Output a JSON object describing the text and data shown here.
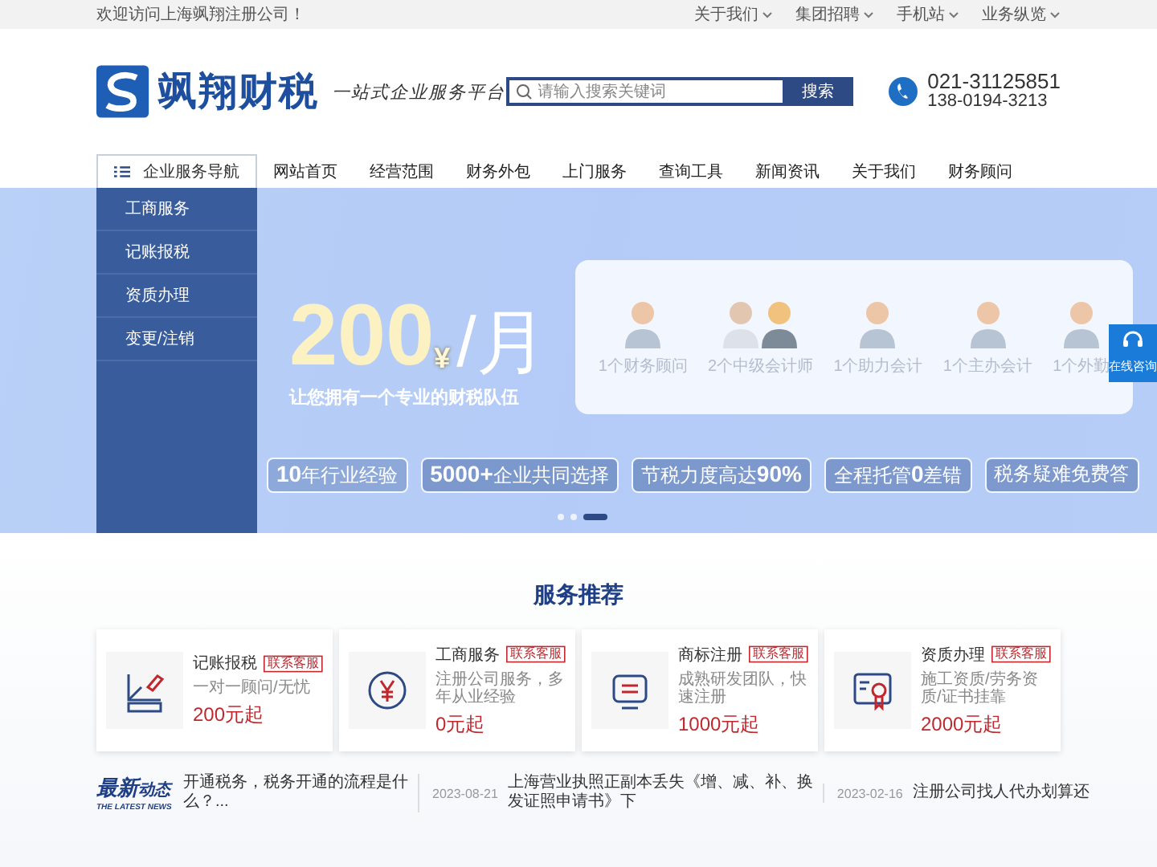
{
  "top_bar": {
    "welcome": "欢迎访问上海飒翔注册公司！",
    "links": [
      "关于我们",
      "集团招聘",
      "手机站",
      "业务纵览"
    ]
  },
  "header": {
    "brand": "飒翔财税",
    "slogan": "一站式企业服务平台",
    "search": {
      "placeholder": "请输入搜索关键词",
      "button": "搜索"
    },
    "phones": [
      "021-31125851",
      "138-0194-3213"
    ]
  },
  "nav": {
    "category_button": "企业服务导航",
    "items": [
      "网站首页",
      "经营范围",
      "财务外包",
      "上门服务",
      "查询工具",
      "新闻资讯",
      "关于我们",
      "财务顾问"
    ]
  },
  "sidebar": {
    "items": [
      "工商服务",
      "记账报税",
      "资质办理",
      "变更/注销"
    ]
  },
  "hero": {
    "price": "200",
    "currency": "¥",
    "unit": "/月",
    "subtitle": "让您拥有一个专业的财税队伍",
    "team": [
      {
        "label": "1个财务顾问",
        "kind": "single"
      },
      {
        "label": "2个中级会计师",
        "kind": "pair"
      },
      {
        "label": "1个助力会计",
        "kind": "single"
      },
      {
        "label": "1个主办会计",
        "kind": "single"
      },
      {
        "label": "1个外勤",
        "kind": "single"
      }
    ],
    "features": [
      "**10**年行业经验",
      "**5000+**企业共同选择",
      "节税力度高达**90%**",
      "全程托管**0**差错",
      "税务疑难免费答"
    ],
    "dots": [
      {
        "selected": false
      },
      {
        "selected": false
      },
      {
        "selected": true
      }
    ]
  },
  "services": {
    "title": "服务推荐",
    "cards": [
      {
        "kind": "ruler",
        "title": "记账报税",
        "tag": "联系客服",
        "desc": "一对一顾问/无忧",
        "price": "200元起"
      },
      {
        "kind": "yen",
        "title": "工商服务",
        "tag": "联系客服",
        "desc": "注册公司服务，多年从业经验",
        "price": "0元起"
      },
      {
        "kind": "screen",
        "title": "商标注册",
        "tag": "联系客服",
        "desc": "成熟研发团队，快速注册",
        "price": "1000元起"
      },
      {
        "kind": "certificate",
        "title": "资质办理",
        "tag": "联系客服",
        "desc": "施工资质/劳务资质/证书挂靠",
        "price": "2000元起"
      }
    ]
  },
  "news": {
    "logo_big": "最新",
    "logo_small": "动态",
    "logo_english": "THE LATEST NEWS",
    "items": [
      {
        "text": "开通税务，税务开通的流程是什么？..."
      },
      {
        "date": "2023-08-21",
        "text": "上海营业执照正副本丢失《增、减、补、换发证照申请书》下"
      },
      {
        "date": "2023-02-16",
        "text": "注册公司找人代办划算还"
      }
    ]
  },
  "chat": {
    "label": "在线咨询"
  }
}
